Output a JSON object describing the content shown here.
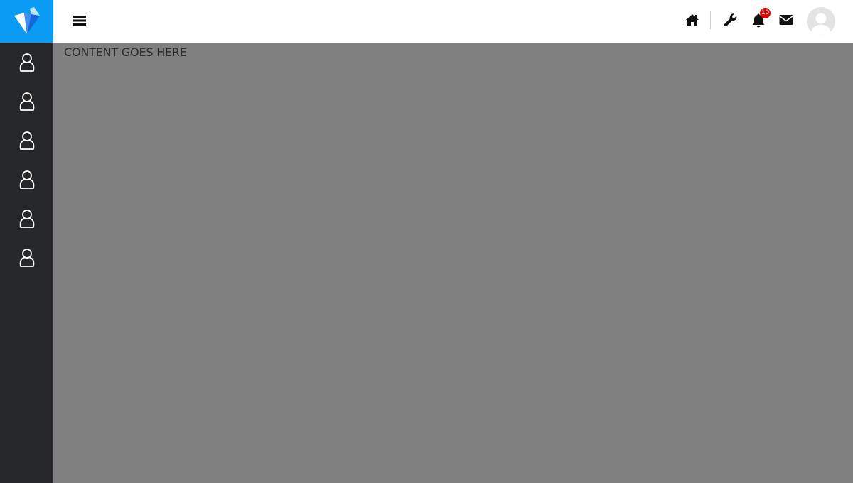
{
  "app": {
    "logo_icon": "diamond-logo-icon",
    "brand_color": "#0a9cf5"
  },
  "sidebar": {
    "background": "#262729",
    "items": [
      {
        "icon": "user-icon"
      },
      {
        "icon": "user-icon"
      },
      {
        "icon": "user-icon"
      },
      {
        "icon": "user-icon"
      },
      {
        "icon": "user-icon"
      },
      {
        "icon": "user-icon"
      }
    ]
  },
  "topbar": {
    "menu_icon": "hamburger-menu-icon",
    "icons": [
      "home-icon",
      "wrench-icon",
      "bell-icon",
      "envelope-icon"
    ],
    "notification_count": "10",
    "avatar": "user-avatar"
  },
  "content": {
    "text": "CONTENT GOES HERE",
    "background": "#808080"
  }
}
